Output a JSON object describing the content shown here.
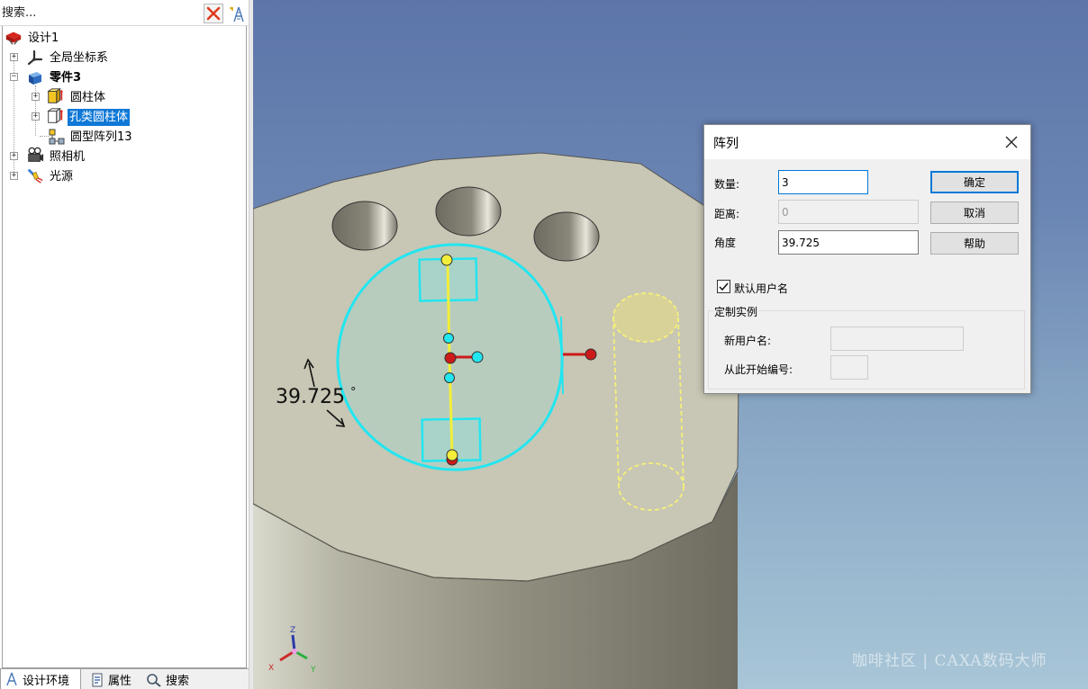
{
  "search": {
    "placeholder": "搜索..."
  },
  "icons": {
    "clear": "close-x-icon",
    "filter": "filter-icon",
    "design": "design-icon",
    "coordinate_system": "axes-icon",
    "part": "part-icon",
    "cylinder": "cylinder-icon",
    "hole_cylinder": "hole-cylinder-icon",
    "pattern": "circular-pattern-icon",
    "camera": "camera-icon",
    "light": "light-icon"
  },
  "tree": {
    "root": "设计1",
    "global_coords": "全局坐标系",
    "part": "零件3",
    "cylinder": "圆柱体",
    "hole_cylinder": "孔类圆柱体",
    "pattern": "圆型阵列13",
    "camera": "照相机",
    "light": "光源"
  },
  "panel_tabs": {
    "design_env": "设计环境",
    "properties": "属性",
    "search": "搜索"
  },
  "viewport": {
    "angle_label": "39.725",
    "degree_symbol": "°",
    "watermark": "咖啡社区 | CAXA数码大师",
    "axes": {
      "z": "Z",
      "x": "X",
      "y": "Y"
    }
  },
  "dialog": {
    "title": "阵列",
    "count_label": "数量:",
    "count_value": "3",
    "distance_label": "距离:",
    "distance_value": "0",
    "angle_label": "角度",
    "angle_value": "39.725",
    "ok": "确定",
    "cancel": "取消",
    "help": "帮助",
    "default_name_label": "默认用户名",
    "default_name_checked": true,
    "custom_group": "定制实例",
    "new_name_label": "新用户名:",
    "new_name_value": "",
    "start_number_label": "从此开始编号:",
    "start_number_value": ""
  },
  "colors": {
    "selection": "#0f78d7",
    "viewport_top": "#5d75a9",
    "viewport_bottom": "#a8c6d7",
    "part_face": "#c8c6b4",
    "handle_cyan": "#22e6f0",
    "handle_yellow": "#f2ee3a",
    "handle_red": "#cc1a1a"
  }
}
